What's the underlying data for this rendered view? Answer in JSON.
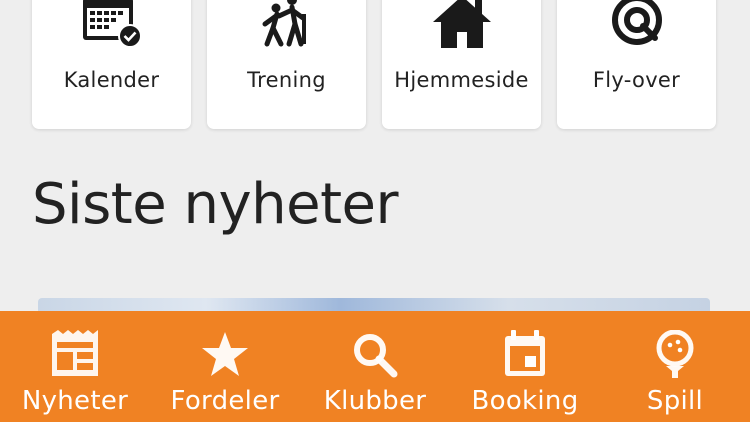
{
  "shortcuts": [
    {
      "label": "Kalender",
      "icon": "calendar-check-icon"
    },
    {
      "label": "Trening",
      "icon": "training-icon"
    },
    {
      "label": "Hjemmeside",
      "icon": "home-icon"
    },
    {
      "label": "Fly-over",
      "icon": "target-icon"
    }
  ],
  "news": {
    "title": "Siste nyheter"
  },
  "bottom_nav": {
    "accent_color": "#f08223",
    "items": [
      {
        "label": "Nyheter",
        "icon": "newspaper-icon"
      },
      {
        "label": "Fordeler",
        "icon": "star-icon"
      },
      {
        "label": "Klubber",
        "icon": "search-icon"
      },
      {
        "label": "Booking",
        "icon": "calendar-icon"
      },
      {
        "label": "Spill",
        "icon": "golf-ball-icon"
      }
    ]
  }
}
